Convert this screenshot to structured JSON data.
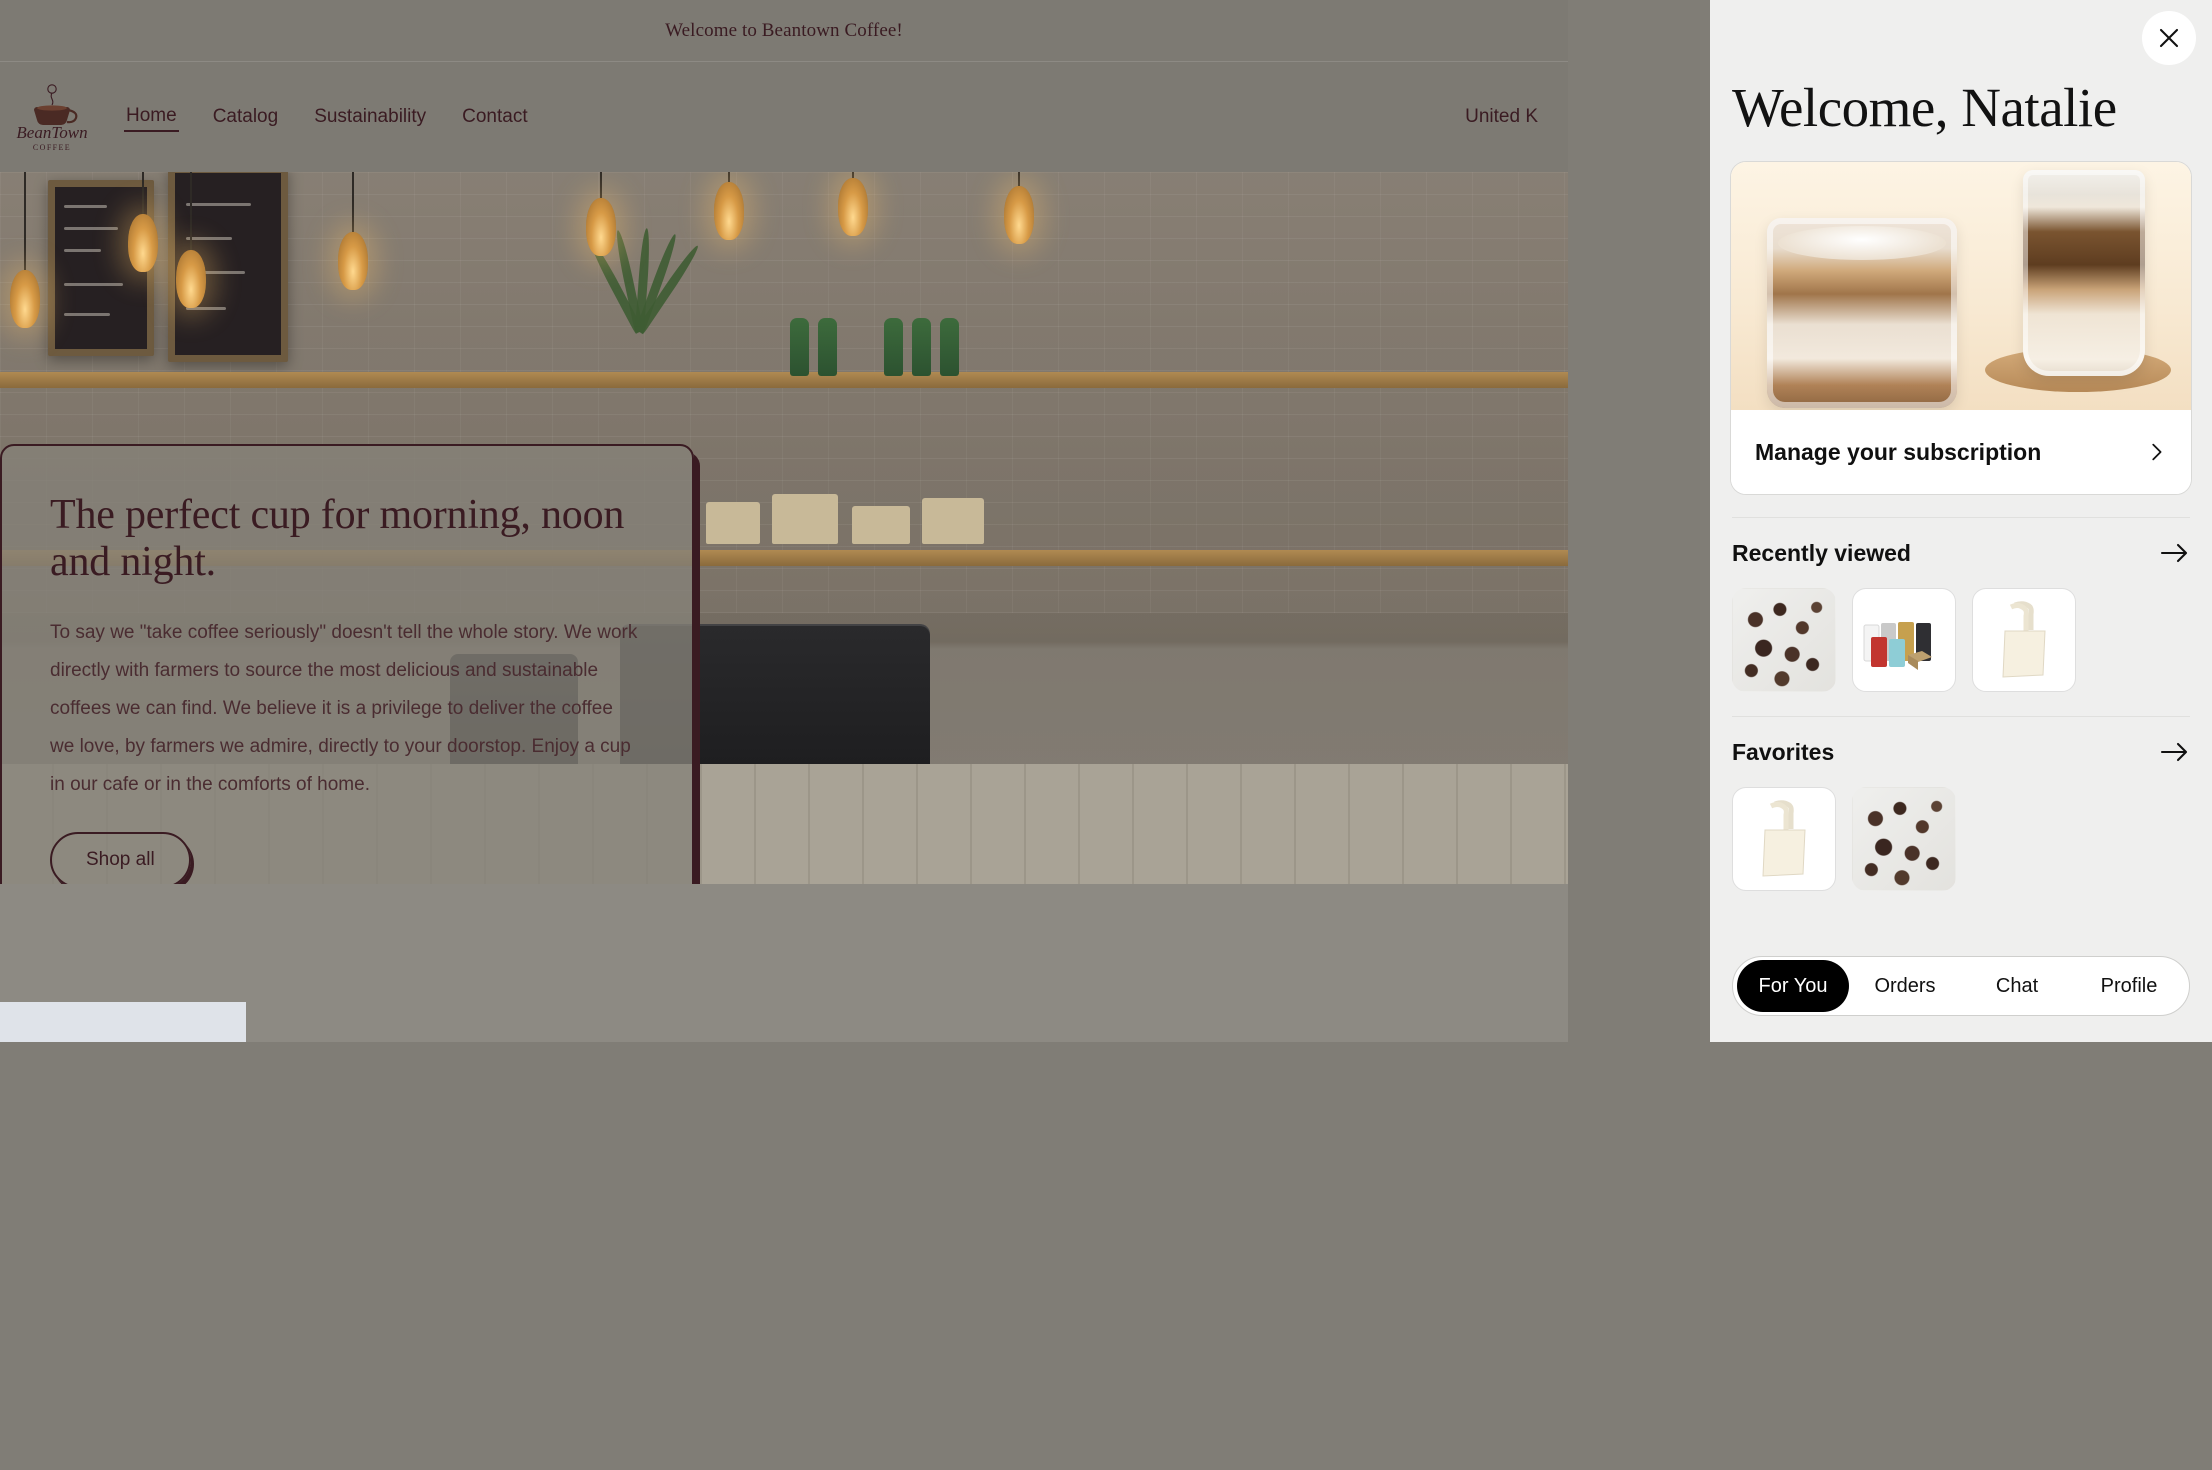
{
  "announcement": {
    "text": "Welcome to Beantown Coffee!"
  },
  "brand": {
    "name": "BeanTown",
    "tagline": "COFFEE"
  },
  "nav": {
    "links": [
      {
        "label": "Home",
        "active": true
      },
      {
        "label": "Catalog",
        "active": false
      },
      {
        "label": "Sustainability",
        "active": false
      },
      {
        "label": "Contact",
        "active": false
      }
    ],
    "country_selector": "United K"
  },
  "hero": {
    "title": "The perfect cup for morning, noon and night.",
    "body": "To say we \"take coffee seriously\" doesn't tell the whole story. We work directly with farmers to source the most delicious and sustainable coffees we can find. We believe it is a privilege to deliver the coffee we love, by farmers we admire, directly to your doorstop. Enjoy a cup in our cafe or in the comforts of home.",
    "cta_label": "Shop all"
  },
  "panel": {
    "close_icon": "close-icon",
    "greeting": "Welcome, Natalie",
    "subscription": {
      "label": "Manage your subscription",
      "chevron_icon": "chevron-right-icon",
      "image_alt": "iced-latte-and-cold-brew"
    },
    "sections": [
      {
        "title": "Recently viewed",
        "arrow_icon": "arrow-right-icon",
        "items": [
          {
            "name": "cacao-nibs",
            "kind": "nibs"
          },
          {
            "name": "coffee-bag-collection",
            "kind": "bags"
          },
          {
            "name": "canvas-tote-bag",
            "kind": "tote"
          }
        ]
      },
      {
        "title": "Favorites",
        "arrow_icon": "arrow-right-icon",
        "items": [
          {
            "name": "canvas-tote-bag",
            "kind": "tote"
          },
          {
            "name": "cacao-nibs",
            "kind": "nibs"
          }
        ]
      }
    ],
    "tabs": [
      {
        "label": "For You",
        "active": true
      },
      {
        "label": "Orders",
        "active": false
      },
      {
        "label": "Chat",
        "active": false
      },
      {
        "label": "Profile",
        "active": false
      }
    ]
  },
  "colors": {
    "brand_dark": "#3a1b22",
    "panel_bg": "#efefee",
    "accent_black": "#000000",
    "card_cream": "#fdf4e4"
  }
}
